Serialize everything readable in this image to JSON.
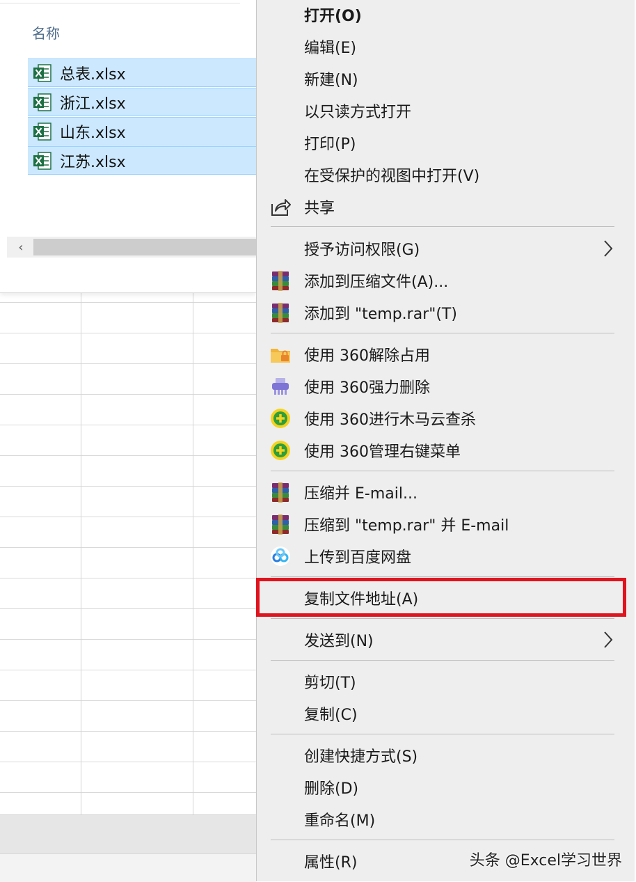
{
  "explorer": {
    "column_header": "名称",
    "files": [
      "总表.xlsx",
      "浙江.xlsx",
      "山东.xlsx",
      "江苏.xlsx"
    ],
    "scroll_left": "‹"
  },
  "menu": {
    "open": "打开(O)",
    "edit": "编辑(E)",
    "new": "新建(N)",
    "open_readonly": "以只读方式打开",
    "print": "打印(P)",
    "open_protected": "在受保护的视图中打开(V)",
    "share": "共享",
    "grant_access": "授予访问权限(G)",
    "add_to_archive": "添加到压缩文件(A)...",
    "add_to_temp_rar": "添加到 \"temp.rar\"(T)",
    "unlock_360": "使用 360解除占用",
    "force_delete_360": "使用 360强力删除",
    "trojan_scan_360": "使用 360进行木马云查杀",
    "manage_menu_360": "使用 360管理右键菜单",
    "compress_email": "压缩并 E-mail...",
    "compress_temp_email": "压缩到 \"temp.rar\" 并 E-mail",
    "upload_baidu": "上传到百度网盘",
    "copy_path": "复制文件地址(A)",
    "send_to": "发送到(N)",
    "cut": "剪切(T)",
    "copy": "复制(C)",
    "create_shortcut": "创建快捷方式(S)",
    "delete": "删除(D)",
    "rename": "重命名(M)",
    "properties": "属性(R)"
  },
  "watermark": "头条 @Excel学习世界",
  "colors": {
    "selection": "#cce8ff",
    "highlight_border": "#e0141e",
    "menu_bg": "#eeeeee",
    "excel_green": "#1d7044"
  }
}
